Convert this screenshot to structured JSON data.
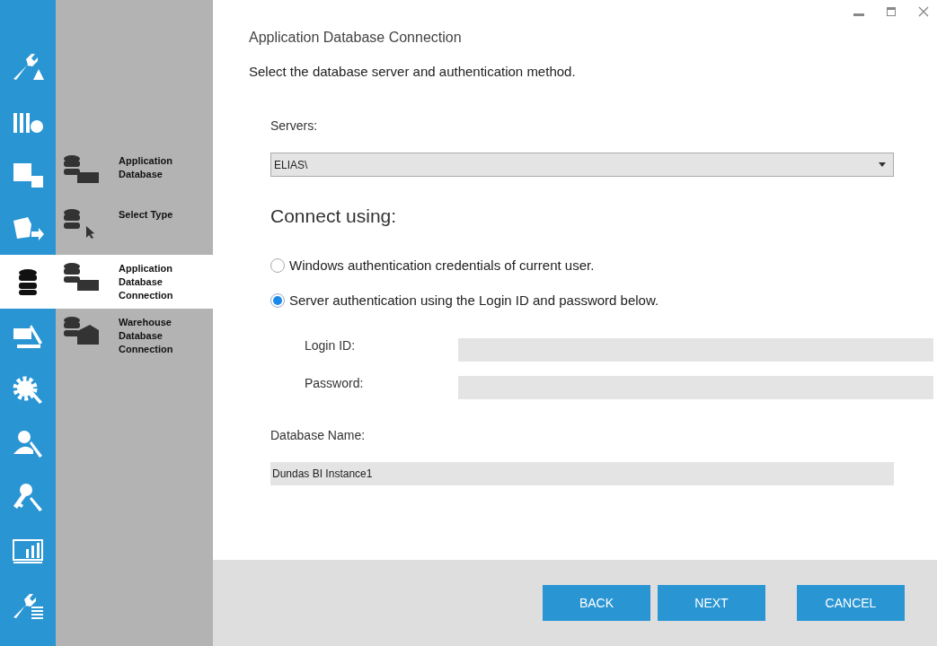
{
  "nav_rail": {
    "items": [
      {
        "selected": false
      },
      {
        "selected": false
      },
      {
        "selected": false
      },
      {
        "selected": false
      },
      {
        "selected": true
      },
      {
        "selected": false
      },
      {
        "selected": false
      },
      {
        "selected": false
      },
      {
        "selected": false
      },
      {
        "selected": false
      },
      {
        "selected": false
      }
    ]
  },
  "steps": [
    {
      "label": "Application Database",
      "selected": false
    },
    {
      "label": "Select Type",
      "selected": false
    },
    {
      "label": "Application Database Connection",
      "selected": true
    },
    {
      "label": "Warehouse Database Connection",
      "selected": false
    }
  ],
  "title": "Application Database Connection",
  "subtitle": "Select the database server and authentication method.",
  "servers": {
    "label": "Servers:",
    "value": "ELIAS\\"
  },
  "connect_heading": "Connect using:",
  "auth_options": [
    {
      "label": "Windows authentication credentials of current user.",
      "selected": false
    },
    {
      "label": "Server authentication using the Login ID and password below.",
      "selected": true
    }
  ],
  "login_id": {
    "label": "Login ID:"
  },
  "password": {
    "label": "Password:"
  },
  "database_name": {
    "label": "Database Name:",
    "value": "Dundas BI Instance1"
  },
  "buttons": [
    {
      "label": "BACK"
    },
    {
      "label": "NEXT"
    },
    {
      "label": "CANCEL"
    }
  ]
}
